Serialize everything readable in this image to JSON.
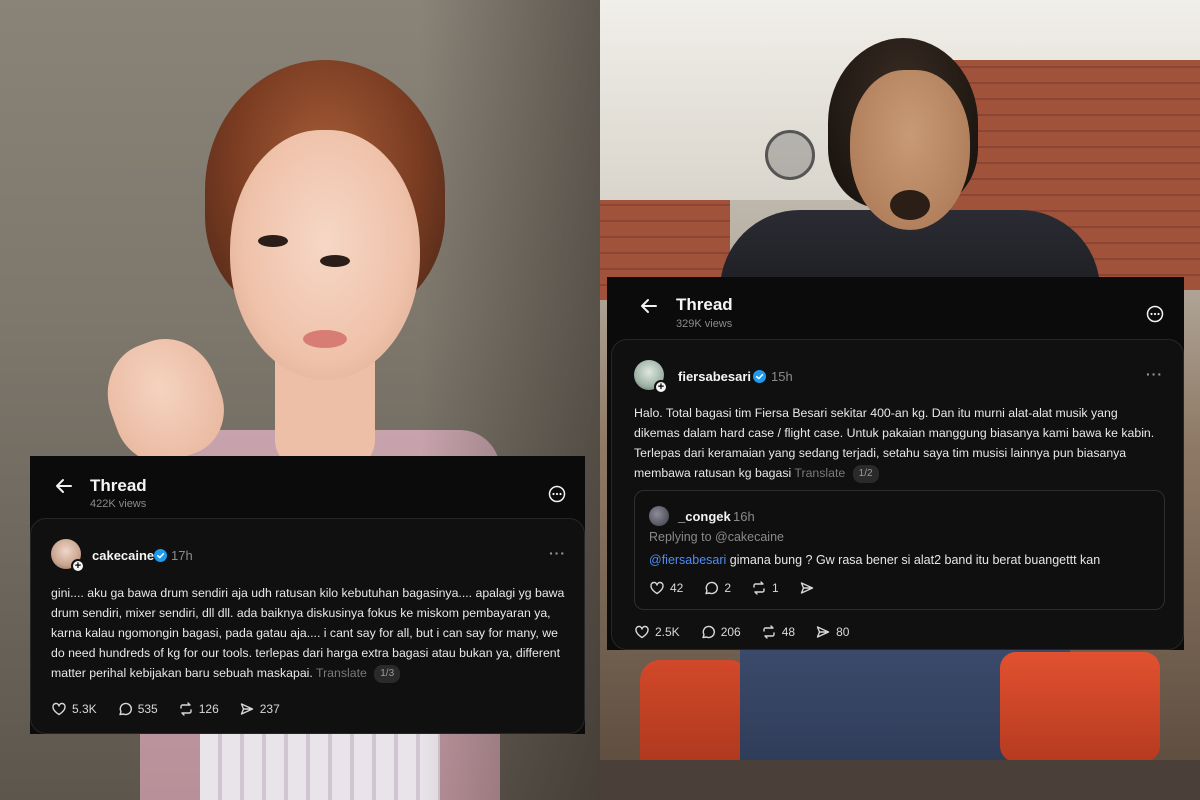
{
  "left_thread": {
    "title": "Thread",
    "views": "422K views",
    "post": {
      "username": "cakecaine",
      "time": "17h",
      "text": "gini.... aku ga bawa drum sendiri aja udh ratusan kilo kebutuhan bagasinya.... apalagi yg bawa drum sendiri, mixer sendiri, dll dll. ada baiknya diskusinya fokus ke miskom pembayaran ya, karna kalau ngomongin bagasi, pada gatau aja.... i cant say for all, but i can say for many, we do need hundreds of kg for our tools. terlepas dari harga extra bagasi atau bukan ya, different matter perihal kebijakan baru sebuah maskapai.",
      "translate": "Translate",
      "pager": "1/3",
      "likes": "5.3K",
      "replies": "535",
      "reposts": "126",
      "shares": "237"
    }
  },
  "right_thread": {
    "title": "Thread",
    "views": "329K views",
    "post": {
      "username": "fiersabesari",
      "time": "15h",
      "text": "Halo. Total bagasi tim Fiersa Besari sekitar 400-an kg. Dan itu murni alat-alat musik yang dikemas dalam hard case / flight case. Untuk pakaian manggung biasanya kami bawa ke kabin. Terlepas dari keramaian yang sedang terjadi, setahu saya tim musisi lainnya pun biasanya membawa ratusan kg bagasi",
      "translate": "Translate",
      "pager": "1/2",
      "likes": "2.5K",
      "replies": "206",
      "reposts": "48",
      "shares": "80",
      "quote": {
        "username": "_congek",
        "time": "16h",
        "replying": "Replying to @cakecaine",
        "mention": "@fiersabesari",
        "text": " gimana bung ? Gw rasa bener si alat2 band itu berat buangettt kan",
        "likes": "42",
        "replies": "2",
        "reposts": "1"
      }
    }
  },
  "colors": {
    "card_bg": "#0b0b0b",
    "verified_blue": "#1d9bf0",
    "mention_blue": "#4d8df5",
    "muted_text": "#8a8a8a"
  },
  "icons": [
    "back-arrow-icon",
    "more-circle-icon",
    "verified-badge-icon",
    "heart-icon",
    "comment-icon",
    "repost-icon",
    "share-icon",
    "more-dots-icon"
  ]
}
